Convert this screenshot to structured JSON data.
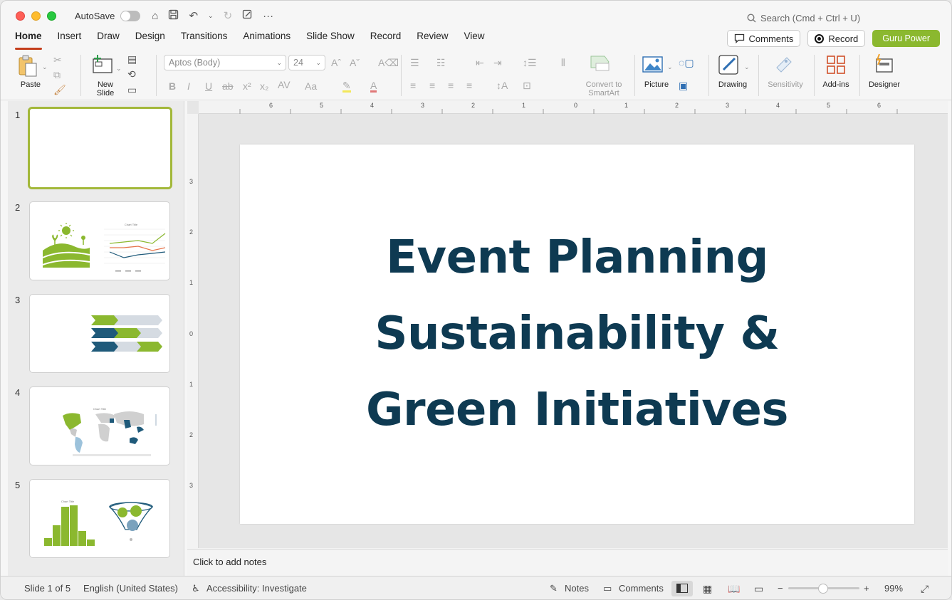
{
  "titlebar": {
    "autosave_label": "AutoSave",
    "search_placeholder": "Search (Cmd + Ctrl + U)"
  },
  "tabs": [
    "Home",
    "Insert",
    "Draw",
    "Design",
    "Transitions",
    "Animations",
    "Slide Show",
    "Record",
    "Review",
    "View"
  ],
  "top_buttons": {
    "comments": "Comments",
    "record": "Record",
    "guru": "Guru Power"
  },
  "ribbon": {
    "paste": "Paste",
    "new_slide": "New Slide",
    "font_name": "Aptos (Body)",
    "font_size": "24",
    "convert_smartart": "Convert to SmartArt",
    "picture": "Picture",
    "drawing": "Drawing",
    "sensitivity": "Sensitivity",
    "addins": "Add-ins",
    "designer": "Designer"
  },
  "thumbnails": [
    "1",
    "2",
    "3",
    "4",
    "5"
  ],
  "slide": {
    "title_line1": "Event Planning",
    "title_line2": "Sustainability &",
    "title_line3": "Green Initiatives"
  },
  "thumb_text": {
    "chart_title": "Chart Title"
  },
  "ruler": {
    "h": [
      "6",
      "5",
      "4",
      "3",
      "2",
      "1",
      "0",
      "1",
      "2",
      "3",
      "4",
      "5",
      "6"
    ],
    "v": [
      "3",
      "2",
      "1",
      "0",
      "1",
      "2",
      "3"
    ]
  },
  "notes_placeholder": "Click to add notes",
  "status": {
    "slide_count": "Slide 1 of 5",
    "language": "English (United States)",
    "accessibility": "Accessibility: Investigate",
    "notes": "Notes",
    "comments": "Comments",
    "zoom": "99%"
  },
  "colors": {
    "accent_green": "#8bb82f",
    "title_navy": "#0e3a52",
    "tab_underline": "#c43e1c"
  }
}
